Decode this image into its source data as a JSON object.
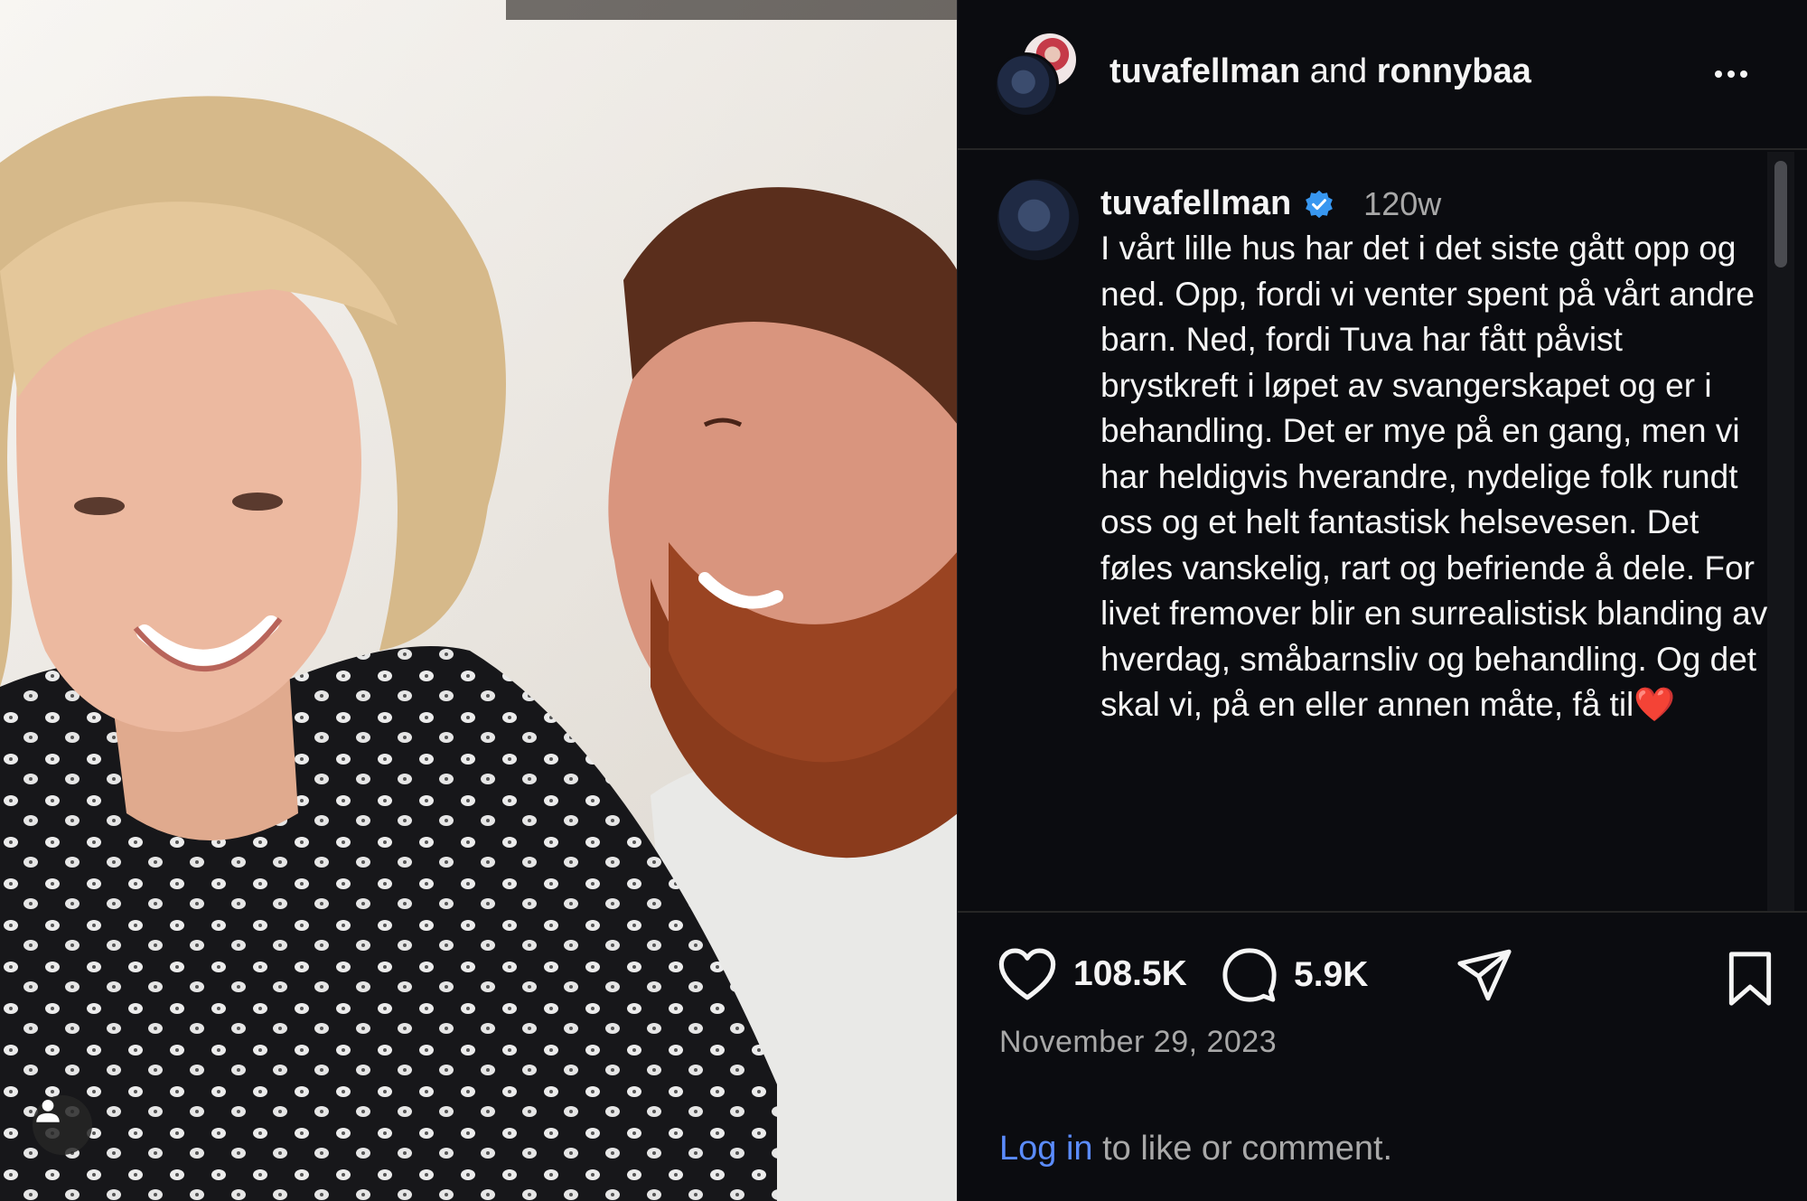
{
  "header": {
    "user1": "tuvafellman",
    "connector": "and",
    "user2": "ronnybaa",
    "more_icon": "more-horizontal-icon"
  },
  "caption": {
    "username": "tuvafellman",
    "verified": true,
    "time_ago": "120w",
    "text": "I vårt lille hus har det i det siste gått opp og ned. Opp, fordi vi venter spent på vårt andre barn. Ned, fordi Tuva har fått påvist brystkreft i løpet av svangerskapet og er i behandling. Det er mye på en gang, men vi har heldigvis hverandre, nydelige folk rundt oss og et helt fantastisk helsevesen. Det føles vanskelig, rart og befriende å dele. For livet fremover blir en surrealistisk blanding av hverdag, småbarnsliv og behandling. Og det skal vi, på en eller annen måte, få til❤️"
  },
  "actions": {
    "likes": "108.5K",
    "comments": "5.9K",
    "icons": [
      "heart-icon",
      "comment-icon",
      "share-icon",
      "bookmark-icon"
    ]
  },
  "date": "November 29, 2023",
  "login": {
    "link": "Log in",
    "rest": " to like or comment."
  },
  "colors": {
    "background": "#0b0c10",
    "text": "#f5f5f5",
    "muted": "#a8a8a8",
    "link": "#5b8cff",
    "verified": "#3897f0"
  }
}
